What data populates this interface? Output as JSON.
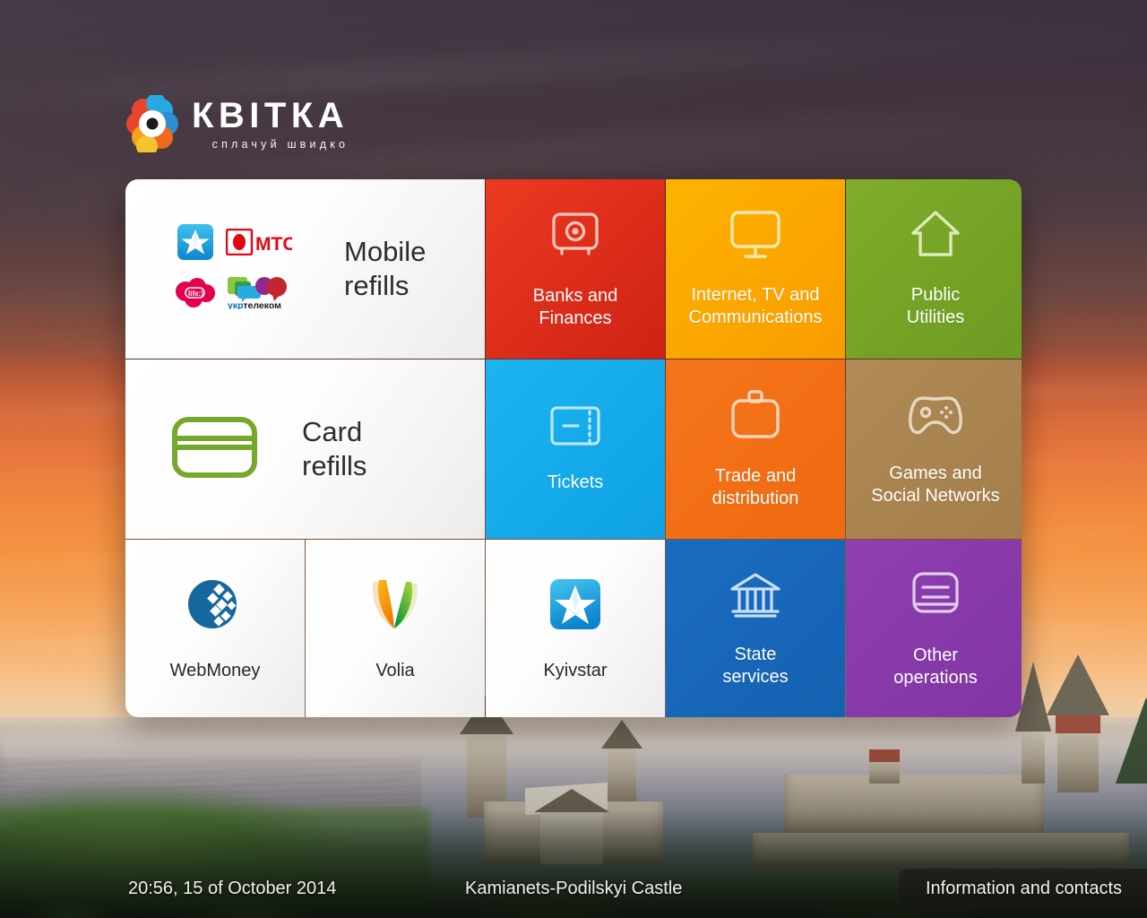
{
  "brand": {
    "name": "КВІТКА",
    "tagline": "сплачуй швидко",
    "logo_icon": "flower-logo-icon",
    "logo_colors": [
      "#e8452c",
      "#f6a21b",
      "#29a9e1",
      "#f4c430"
    ]
  },
  "grid": {
    "rows": [
      {
        "tiles": [
          {
            "id": "mobile-refills",
            "kind": "wide-operators",
            "label": "Mobile\nrefills",
            "label_line1": "Mobile",
            "label_line2": "refills",
            "bg": "#ffffff",
            "text_color": "#2d2d2d",
            "operators": [
              {
                "name": "Kyivstar",
                "icon": "kyivstar-star-icon",
                "color": "#1aa3e0"
              },
              {
                "name": "MTS",
                "icon": "mts-egg-icon",
                "color": "#e30611"
              },
              {
                "name": "life:)",
                "icon": "life-cloud-icon",
                "color": "#e4004f"
              },
              {
                "name": "Укртелеком",
                "icon": "ukrtelecom-bubbles-icon",
                "color": "#7ab800"
              }
            ]
          },
          {
            "id": "banks-and-finances",
            "kind": "color",
            "label_line1": "Banks and",
            "label_line2": "Finances",
            "icon": "safe-vault-icon",
            "bg": "#ec3a21",
            "bg_to": "#cf2214"
          },
          {
            "id": "internet-tv-communications",
            "kind": "color",
            "label_line1": "Internet, TV and",
            "label_line2": "Communications",
            "icon": "monitor-tv-icon",
            "bg": "#fdb300",
            "bg_to": "#f99c00"
          },
          {
            "id": "public-utilities",
            "kind": "color",
            "label_line1": "Public",
            "label_line2": "Utilities",
            "icon": "house-home-icon",
            "bg": "#7fad2a",
            "bg_to": "#6d9a22"
          }
        ]
      },
      {
        "tiles": [
          {
            "id": "card-refills",
            "kind": "wide-card",
            "label_line1": "Card",
            "label_line2": "refills",
            "icon": "credit-card-icon",
            "icon_color": "#76a82b",
            "bg": "#ffffff",
            "text_color": "#2d2d2d"
          },
          {
            "id": "tickets",
            "kind": "color",
            "label_line1": "Tickets",
            "label_line2": "",
            "icon": "ticket-icon",
            "bg": "#1cb4f0",
            "bg_to": "#0ea2e4"
          },
          {
            "id": "trade-and-distribution",
            "kind": "color",
            "label_line1": "Trade and",
            "label_line2": "distribution",
            "icon": "briefcase-icon",
            "bg": "#f5741a",
            "bg_to": "#ef6a10"
          },
          {
            "id": "games-and-social-networks",
            "kind": "color",
            "label_line1": "Games and",
            "label_line2": "Social Networks",
            "icon": "gamepad-icon",
            "bg": "#b18a55",
            "bg_to": "#a37e4b"
          }
        ]
      },
      {
        "tiles": [
          {
            "id": "webmoney",
            "kind": "light-brand",
            "label_line1": "WebMoney",
            "label_line2": "",
            "icon": "webmoney-logo-icon",
            "bg": "#ffffff",
            "text_color": "#272727"
          },
          {
            "id": "volia",
            "kind": "light-brand",
            "label_line1": "Volia",
            "label_line2": "",
            "icon": "volia-logo-icon",
            "bg": "#ffffff",
            "text_color": "#272727"
          },
          {
            "id": "kyivstar",
            "kind": "light-brand",
            "label_line1": "Kyivstar",
            "label_line2": "",
            "icon": "kyivstar-logo-icon",
            "bg": "#ffffff",
            "text_color": "#272727"
          },
          {
            "id": "state-services",
            "kind": "color",
            "label_line1": "State",
            "label_line2": "services",
            "icon": "bank-building-icon",
            "bg": "#1b6cc0",
            "bg_to": "#1561b2"
          },
          {
            "id": "other-operations",
            "kind": "color",
            "label_line1": "Other",
            "label_line2": "operations",
            "icon": "list-stack-icon",
            "bg": "#8f3fb0",
            "bg_to": "#8135a3"
          }
        ]
      }
    ]
  },
  "bottom_bar": {
    "datetime": "20:56, 15 of October 2014",
    "location": "Kamianets-Podilskyi Castle",
    "info_button": "Information and contacts"
  }
}
